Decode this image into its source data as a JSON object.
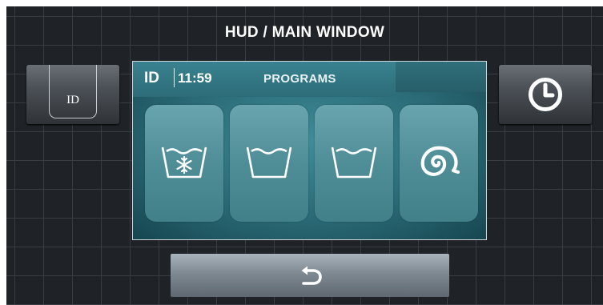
{
  "window": {
    "title": "HUD / MAIN WINDOW"
  },
  "left_button": {
    "label": "ID"
  },
  "right_button": {
    "icon": "clock-icon"
  },
  "screen": {
    "header": {
      "id": "ID",
      "time": "11:59",
      "section": "PROGRAMS"
    },
    "programs": [
      {
        "icon": "wash-cold-icon"
      },
      {
        "icon": "wash-icon"
      },
      {
        "icon": "wash-icon"
      },
      {
        "icon": "spin-icon"
      }
    ]
  },
  "back_button": {
    "icon": "back-arrow-icon"
  },
  "colors": {
    "background": "#1f2327",
    "screen_teal": "#2a6a76",
    "tile": "#5a98a2"
  }
}
